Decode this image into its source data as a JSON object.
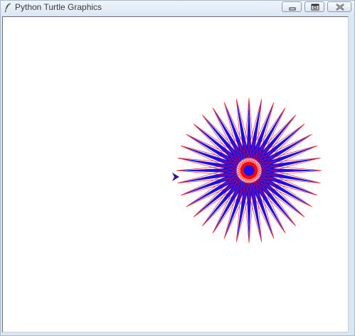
{
  "window": {
    "title": "Python Turtle Graphics",
    "icon": "feather-icon"
  },
  "title_buttons": {
    "minimize": "minimize-icon",
    "maximize": "maximize-icon",
    "close": "close-icon"
  },
  "drawing": {
    "shape": "star burst",
    "spikes": 36,
    "fill_color": "#1a0ff0",
    "line_color": "#ff0000",
    "turtle_color": "#3b0c8c"
  },
  "colors": {
    "title_text": "#3a3a3a",
    "canvas_bg": "#ffffff",
    "chrome": "#dbe6f3"
  }
}
